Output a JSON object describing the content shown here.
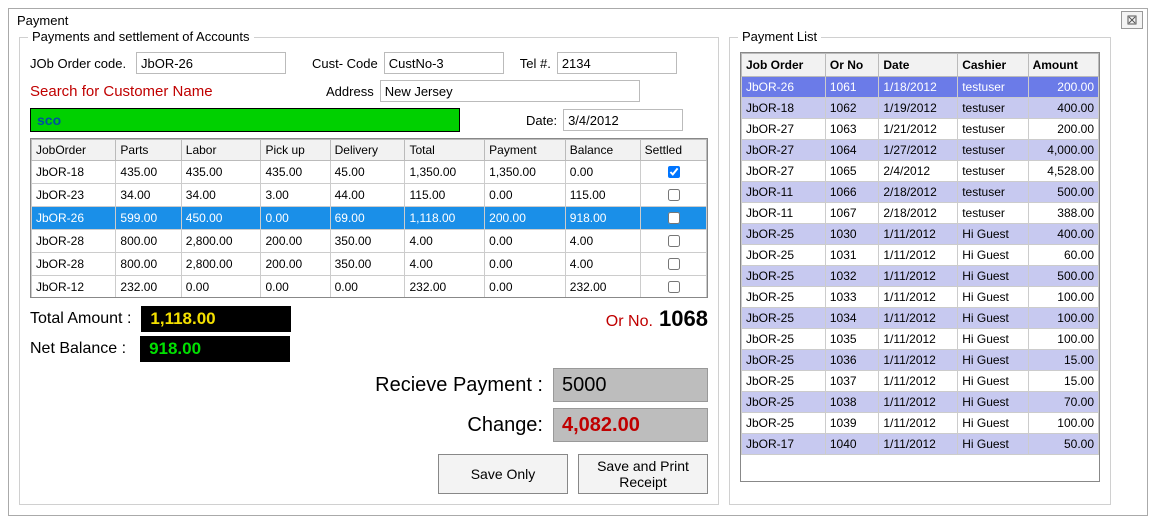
{
  "window_title": "Payment",
  "left": {
    "panel_title": "Payments and settlement of Accounts",
    "labels": {
      "job_order_code": "JOb Order code.",
      "cust_code": "Cust- Code",
      "tel": "Tel #.",
      "search": "Search for Customer Name",
      "address": "Address",
      "date": "Date:"
    },
    "fields": {
      "job_order_code": "JbOR-26",
      "cust_code": "CustNo-3",
      "tel": "2134",
      "search": "sco",
      "address": "New Jersey",
      "date": "3/4/2012"
    },
    "grid_headers": [
      "JobOrder",
      "Parts",
      "Labor",
      "Pick up",
      "Delivery",
      "Total",
      "Payment",
      "Balance",
      "Settled"
    ],
    "grid_rows": [
      {
        "c": [
          "JbOR-18",
          "435.00",
          "435.00",
          "435.00",
          "45.00",
          "1,350.00",
          "1,350.00",
          "0.00"
        ],
        "settled": true,
        "sel": false
      },
      {
        "c": [
          "JbOR-23",
          "34.00",
          "34.00",
          "3.00",
          "44.00",
          "115.00",
          "0.00",
          "115.00"
        ],
        "settled": false,
        "sel": false
      },
      {
        "c": [
          "JbOR-26",
          "599.00",
          "450.00",
          "0.00",
          "69.00",
          "1,118.00",
          "200.00",
          "918.00"
        ],
        "settled": false,
        "sel": true
      },
      {
        "c": [
          "JbOR-28",
          "800.00",
          "2,800.00",
          "200.00",
          "350.00",
          "4.00",
          "0.00",
          "4.00"
        ],
        "settled": false,
        "sel": false
      },
      {
        "c": [
          "JbOR-28",
          "800.00",
          "2,800.00",
          "200.00",
          "350.00",
          "4.00",
          "0.00",
          "4.00"
        ],
        "settled": false,
        "sel": false
      },
      {
        "c": [
          "JbOR-12",
          "232.00",
          "0.00",
          "0.00",
          "0.00",
          "232.00",
          "0.00",
          "232.00"
        ],
        "settled": false,
        "sel": false
      }
    ],
    "totals": {
      "total_label": "Total Amount :",
      "total_value": "1,118.00",
      "net_label": "Net Balance :",
      "net_value": "918.00"
    },
    "orno_label": "Or No.",
    "orno_value": "1068",
    "recv_label": "Recieve Payment :",
    "recv_value": "5000",
    "change_label": "Change:",
    "change_value": "4,082.00",
    "save_only": "Save Only",
    "save_print": "Save and Print Receipt"
  },
  "right": {
    "panel_title": "Payment List",
    "headers": [
      "Job Order",
      "Or No",
      "Date",
      "Cashier",
      "Amount"
    ],
    "rows": [
      {
        "c": [
          "JbOR-26",
          "1061",
          "1/18/2012",
          "testuser",
          "200.00"
        ],
        "sel": true
      },
      {
        "c": [
          "JbOR-18",
          "1062",
          "1/19/2012",
          "testuser",
          "400.00"
        ],
        "alt": true
      },
      {
        "c": [
          "JbOR-27",
          "1063",
          "1/21/2012",
          "testuser",
          "200.00"
        ]
      },
      {
        "c": [
          "JbOR-27",
          "1064",
          "1/27/2012",
          "testuser",
          "4,000.00"
        ],
        "alt": true
      },
      {
        "c": [
          "JbOR-27",
          "1065",
          "2/4/2012",
          "testuser",
          "4,528.00"
        ]
      },
      {
        "c": [
          "JbOR-11",
          "1066",
          "2/18/2012",
          "testuser",
          "500.00"
        ],
        "alt": true
      },
      {
        "c": [
          "JbOR-11",
          "1067",
          "2/18/2012",
          "testuser",
          "388.00"
        ]
      },
      {
        "c": [
          "JbOR-25",
          "1030",
          "1/11/2012",
          "Hi Guest",
          "400.00"
        ],
        "alt": true
      },
      {
        "c": [
          "JbOR-25",
          "1031",
          "1/11/2012",
          "Hi Guest",
          "60.00"
        ]
      },
      {
        "c": [
          "JbOR-25",
          "1032",
          "1/11/2012",
          "Hi Guest",
          "500.00"
        ],
        "alt": true
      },
      {
        "c": [
          "JbOR-25",
          "1033",
          "1/11/2012",
          "Hi Guest",
          "100.00"
        ]
      },
      {
        "c": [
          "JbOR-25",
          "1034",
          "1/11/2012",
          "Hi Guest",
          "100.00"
        ],
        "alt": true
      },
      {
        "c": [
          "JbOR-25",
          "1035",
          "1/11/2012",
          "Hi Guest",
          "100.00"
        ]
      },
      {
        "c": [
          "JbOR-25",
          "1036",
          "1/11/2012",
          "Hi Guest",
          "15.00"
        ],
        "alt": true
      },
      {
        "c": [
          "JbOR-25",
          "1037",
          "1/11/2012",
          "Hi Guest",
          "15.00"
        ]
      },
      {
        "c": [
          "JbOR-25",
          "1038",
          "1/11/2012",
          "Hi Guest",
          "70.00"
        ],
        "alt": true
      },
      {
        "c": [
          "JbOR-25",
          "1039",
          "1/11/2012",
          "Hi Guest",
          "100.00"
        ]
      },
      {
        "c": [
          "JbOR-17",
          "1040",
          "1/11/2012",
          "Hi Guest",
          "50.00"
        ],
        "alt": true
      }
    ]
  }
}
